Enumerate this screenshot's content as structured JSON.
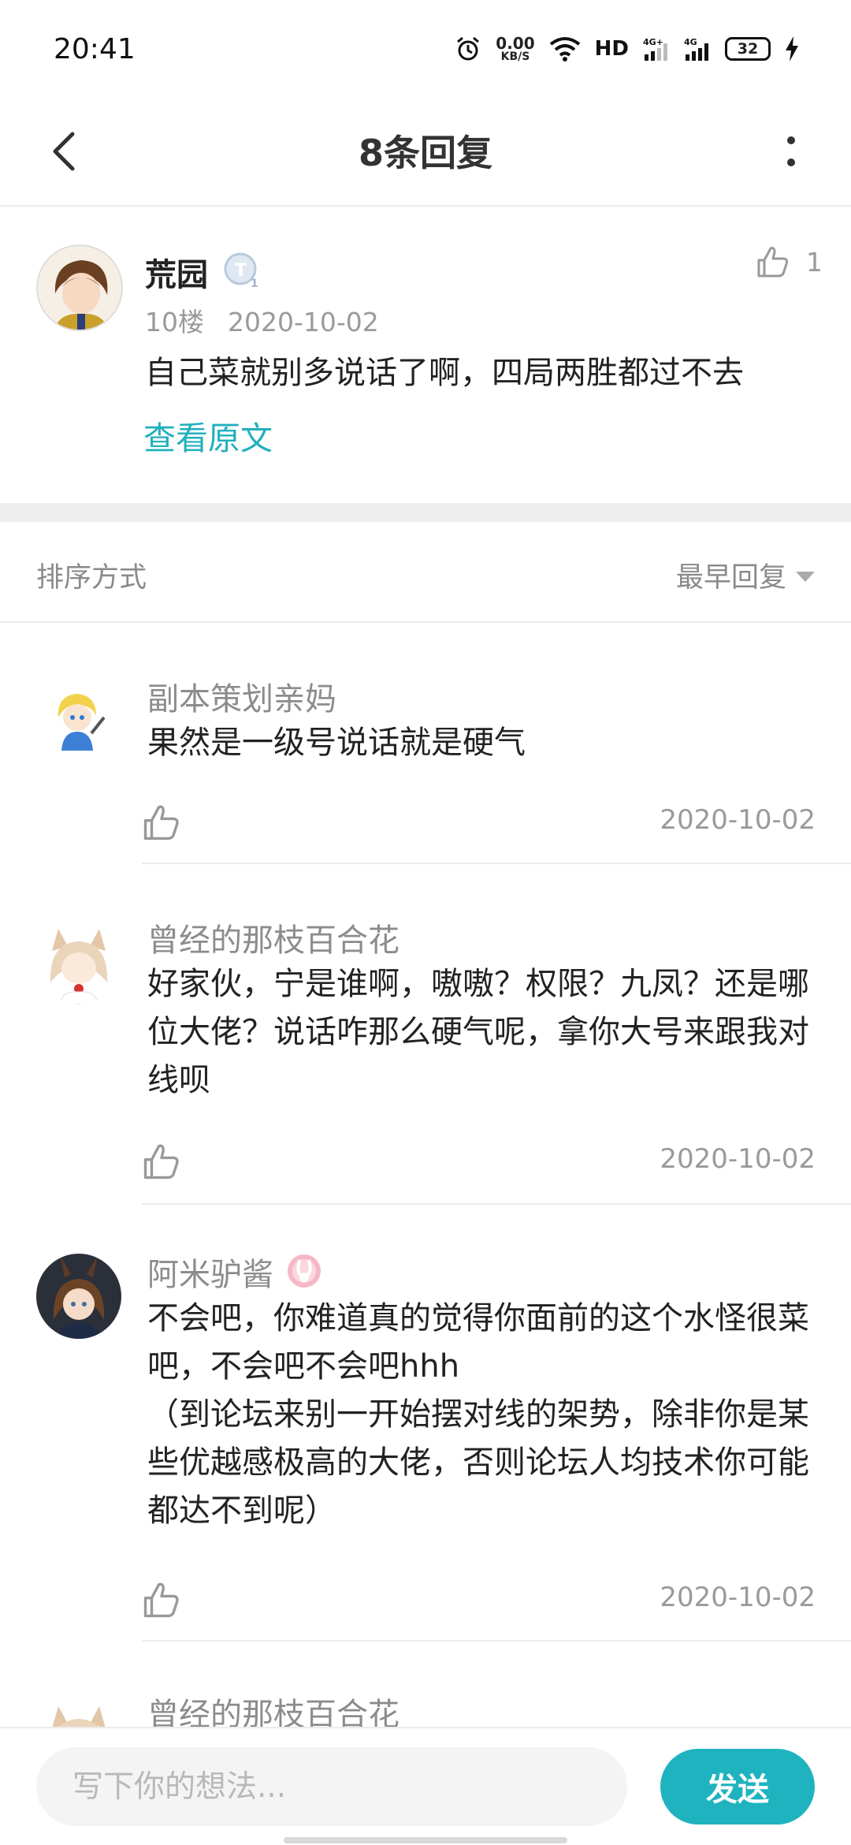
{
  "status_bar": {
    "time": "20:41",
    "net_speed_value": "0.00",
    "net_speed_unit": "KB/S",
    "hd_label": "HD",
    "sim1_label": "4G+",
    "sim2_label": "4G",
    "battery": "32"
  },
  "header": {
    "title": "8条回复"
  },
  "main_post": {
    "author": "荒园",
    "floor": "10楼",
    "date": "2020-10-02",
    "content": "自己菜就别多说话了啊，四局两胜都过不去",
    "like_count": "1",
    "view_original": "查看原文"
  },
  "sort": {
    "label": "排序方式",
    "current": "最早回复"
  },
  "replies": [
    {
      "author": "副本策划亲妈",
      "text": "果然是一级号说话就是硬气",
      "date": "2020-10-02"
    },
    {
      "author": "曾经的那枝百合花",
      "text": "好家伙，宁是谁啊，嗷嗷？权限？九凤？还是哪位大佬？说话咋那么硬气呢，拿你大号来跟我对线呗",
      "date": "2020-10-02"
    },
    {
      "author": "阿米驴酱",
      "text": "不会吧，你难道真的觉得你面前的这个水怪很菜吧，不会吧不会吧hhh\n（到论坛来别一开始摆对线的架势，除非你是某些优越感极高的大佬，否则论坛人均技术你可能都达不到呢）",
      "date": "2020-10-02"
    },
    {
      "author": "曾经的那枝百合花"
    }
  ],
  "input": {
    "placeholder": "写下你的想法..."
  },
  "send_label": "发送",
  "colors": {
    "accent": "#1fb3bf",
    "link": "#21b0bd"
  }
}
